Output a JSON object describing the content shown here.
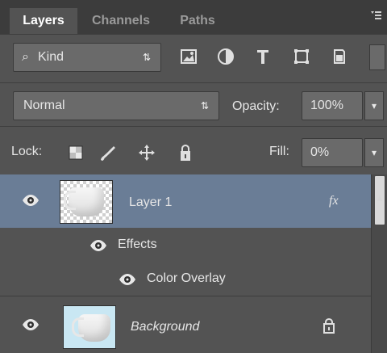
{
  "panel": {
    "tabs": [
      {
        "label": "Layers",
        "active": true
      },
      {
        "label": "Channels",
        "active": false
      },
      {
        "label": "Paths",
        "active": false
      }
    ],
    "filter": {
      "kind_label": "Kind"
    },
    "blend": {
      "mode": "Normal",
      "opacity_label": "Opacity:",
      "opacity_value": "100%"
    },
    "lock": {
      "label": "Lock:",
      "fill_label": "Fill:",
      "fill_value": "0%"
    },
    "layers": [
      {
        "name": "Layer 1",
        "fx": "fx",
        "selected": true
      },
      {
        "effects_label": "Effects",
        "overlay_label": "Color Overlay"
      },
      {
        "name": "Background",
        "locked": true
      }
    ],
    "colors": {
      "panel_bg": "#535353",
      "selected_layer_bg": "#6a7d96",
      "tab_bar_bg": "#3c3c3c"
    }
  }
}
